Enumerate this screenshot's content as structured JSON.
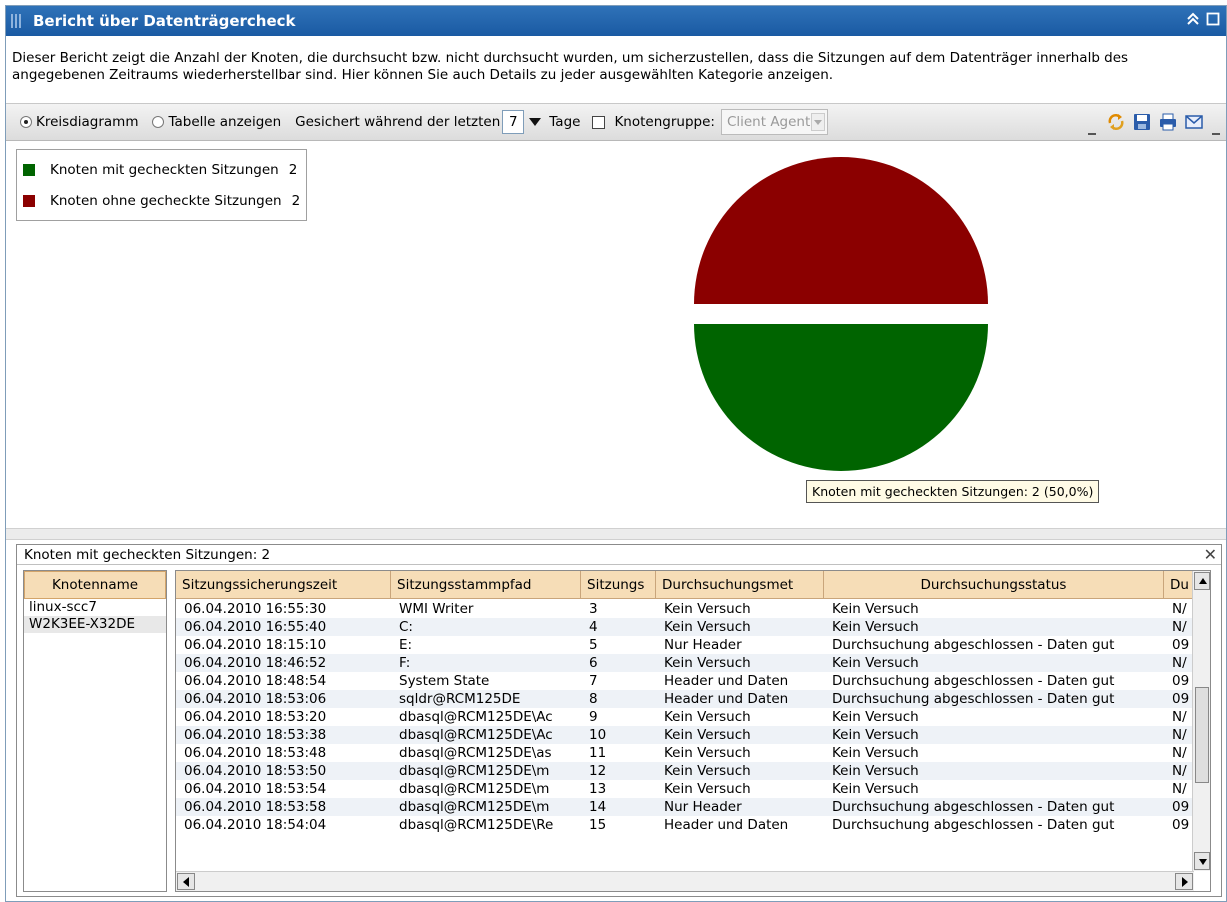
{
  "window": {
    "title": "Bericht über Datenträgercheck"
  },
  "description": "Dieser Bericht zeigt die Anzahl der Knoten, die durchsucht bzw. nicht durchsucht wurden, um sicherzustellen, dass die Sitzungen auf dem Datenträger innerhalb des angegebenen Zeitraums wiederherstellbar sind. Hier können Sie auch Details zu jeder ausgewählten Kategorie anzeigen.",
  "toolbar": {
    "radio_pie": "Kreisdiagramm",
    "radio_table": "Tabelle anzeigen",
    "saved_label": "Gesichert während der letzten",
    "days_value": "7",
    "days_label": "Tage",
    "nodegroup_label": "Knotengruppe:",
    "nodegroup_value": "Client Agent",
    "pie_selected": true,
    "nodegroup_checked": false
  },
  "colors": {
    "checked": "#006400",
    "unchecked": "#8b0000",
    "title_bar": "#2266b0"
  },
  "chart_data": {
    "type": "pie",
    "title": "",
    "legend_position": "top-left",
    "slices": [
      {
        "label": "Knoten mit gecheckten Sitzungen",
        "value": 2,
        "color": "#006400"
      },
      {
        "label": "Knoten ohne gecheckte Sitzungen",
        "value": 2,
        "color": "#8b0000"
      }
    ],
    "tooltip": "Knoten mit gecheckten Sitzungen: 2 (50,0%)"
  },
  "legend": {
    "items": [
      {
        "label": "Knoten mit gecheckten Sitzungen",
        "value": "2"
      },
      {
        "label": "Knoten ohne gecheckte Sitzungen",
        "value": "2"
      }
    ]
  },
  "details": {
    "header": "Knoten mit gecheckten Sitzungen: 2",
    "nodes_header": "Knotenname",
    "nodes": [
      "linux-scc7",
      "W2K3EE-X32DE"
    ],
    "selected_node": 1,
    "columns": [
      "Sitzungssicherungszeit",
      "Sitzungsstammpfad",
      "Sitzungs",
      "Durchsuchungsmet",
      "Durchsuchungsstatus",
      "Du"
    ],
    "rows": [
      [
        "06.04.2010 16:55:30",
        "WMI Writer",
        "3",
        "Kein Versuch",
        "Kein Versuch",
        "N/"
      ],
      [
        "06.04.2010 16:55:40",
        "C:",
        "4",
        "Kein Versuch",
        "Kein Versuch",
        "N/"
      ],
      [
        "06.04.2010 18:15:10",
        "E:",
        "5",
        "Nur Header",
        "Durchsuchung abgeschlossen - Daten gut",
        "09"
      ],
      [
        "06.04.2010 18:46:52",
        "F:",
        "6",
        "Kein Versuch",
        "Kein Versuch",
        "N/"
      ],
      [
        "06.04.2010 18:48:54",
        "System State",
        "7",
        "Header und Daten",
        "Durchsuchung abgeschlossen - Daten gut",
        "09"
      ],
      [
        "06.04.2010 18:53:06",
        "sqldr@RCM125DE",
        "8",
        "Header und Daten",
        "Durchsuchung abgeschlossen - Daten gut",
        "09"
      ],
      [
        "06.04.2010 18:53:20",
        "dbasql@RCM125DE\\Ac",
        "9",
        "Kein Versuch",
        "Kein Versuch",
        "N/"
      ],
      [
        "06.04.2010 18:53:38",
        "dbasql@RCM125DE\\Ac",
        "10",
        "Kein Versuch",
        "Kein Versuch",
        "N/"
      ],
      [
        "06.04.2010 18:53:48",
        "dbasql@RCM125DE\\as",
        "11",
        "Kein Versuch",
        "Kein Versuch",
        "N/"
      ],
      [
        "06.04.2010 18:53:50",
        "dbasql@RCM125DE\\m",
        "12",
        "Kein Versuch",
        "Kein Versuch",
        "N/"
      ],
      [
        "06.04.2010 18:53:54",
        "dbasql@RCM125DE\\m",
        "13",
        "Kein Versuch",
        "Kein Versuch",
        "N/"
      ],
      [
        "06.04.2010 18:53:58",
        "dbasql@RCM125DE\\m",
        "14",
        "Nur Header",
        "Durchsuchung abgeschlossen - Daten gut",
        "09"
      ],
      [
        "06.04.2010 18:54:04",
        "dbasql@RCM125DE\\Re",
        "15",
        "Header und Daten",
        "Durchsuchung abgeschlossen - Daten gut",
        "09"
      ]
    ]
  }
}
